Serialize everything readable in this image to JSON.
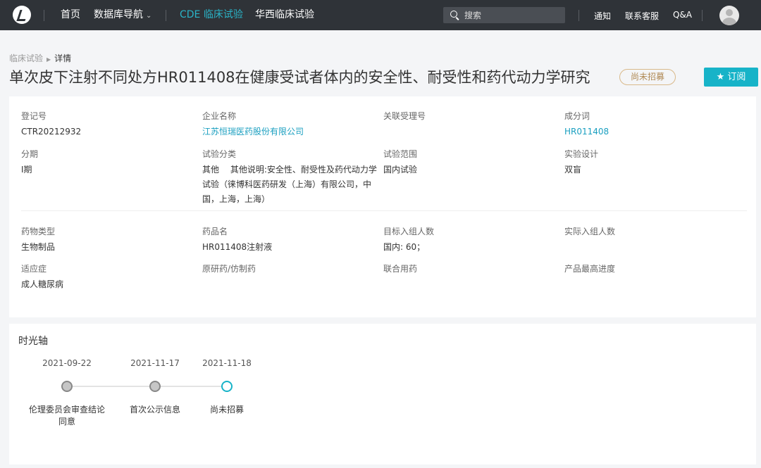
{
  "nav": {
    "home": "首页",
    "database_nav": "数据库导航",
    "cde_trials": "CDE 临床试验",
    "huaxi_trials": "华西临床试验",
    "search_placeholder": "搜索",
    "notify": "通知",
    "contact": "联系客服",
    "qa": "Q&A"
  },
  "breadcrumb": {
    "parent": "临床试验",
    "current": "详情"
  },
  "page": {
    "title": "单次皮下注射不同处方HR011408在健康受试者体内的安全性、耐受性和药代动力学研究",
    "status": "尚未招募",
    "subscribe_label": "订阅"
  },
  "info": {
    "reg_no": {
      "label": "登记号",
      "value": "CTR20212932"
    },
    "company": {
      "label": "企业名称",
      "value": "江苏恒瑞医药股份有限公司"
    },
    "related_no": {
      "label": "关联受理号",
      "value": ""
    },
    "ingredient": {
      "label": "成分词",
      "value": "HR011408"
    },
    "phase": {
      "label": "分期",
      "value": "I期"
    },
    "trial_class": {
      "label": "试验分类",
      "value": "其他　 其他说明:安全性、耐受性及药代动力学试验（徕博科医药研发（上海）有限公司，中国，上海，上海）"
    },
    "trial_scope": {
      "label": "试验范围",
      "value": "国内试验"
    },
    "design": {
      "label": "实验设计",
      "value": "双盲"
    },
    "drug_type": {
      "label": "药物类型",
      "value": "生物制品"
    },
    "drug_name": {
      "label": "药品名",
      "value": "HR011408注射液"
    },
    "target_enroll": {
      "label": "目标入组人数",
      "value": "国内: 60；"
    },
    "actual_enroll": {
      "label": "实际入组人数",
      "value": ""
    },
    "indication": {
      "label": "适应症",
      "value": "成人糖尿病"
    },
    "original_generic": {
      "label": "原研药/仿制药",
      "value": ""
    },
    "combo": {
      "label": "联合用药",
      "value": ""
    },
    "max_progress": {
      "label": "产品最高进度",
      "value": ""
    }
  },
  "timeline": {
    "title": "时光轴",
    "events": [
      {
        "date": "2021-09-22",
        "label": "伦理委员会审查结论同意",
        "current": false
      },
      {
        "date": "2021-11-17",
        "label": "首次公示信息",
        "current": false
      },
      {
        "date": "2021-11-18",
        "label": "尚未招募",
        "current": true
      }
    ]
  },
  "icons": {
    "logo": "brand-logo-icon",
    "search": "search-icon",
    "chevron": "chevron-down-icon",
    "star": "star-icon",
    "avatar": "user-avatar-icon"
  },
  "colors": {
    "nav_bg": "#2f3338",
    "accent": "#17b3c8",
    "link": "#1a9fc0",
    "status_border": "#d9b98a"
  }
}
